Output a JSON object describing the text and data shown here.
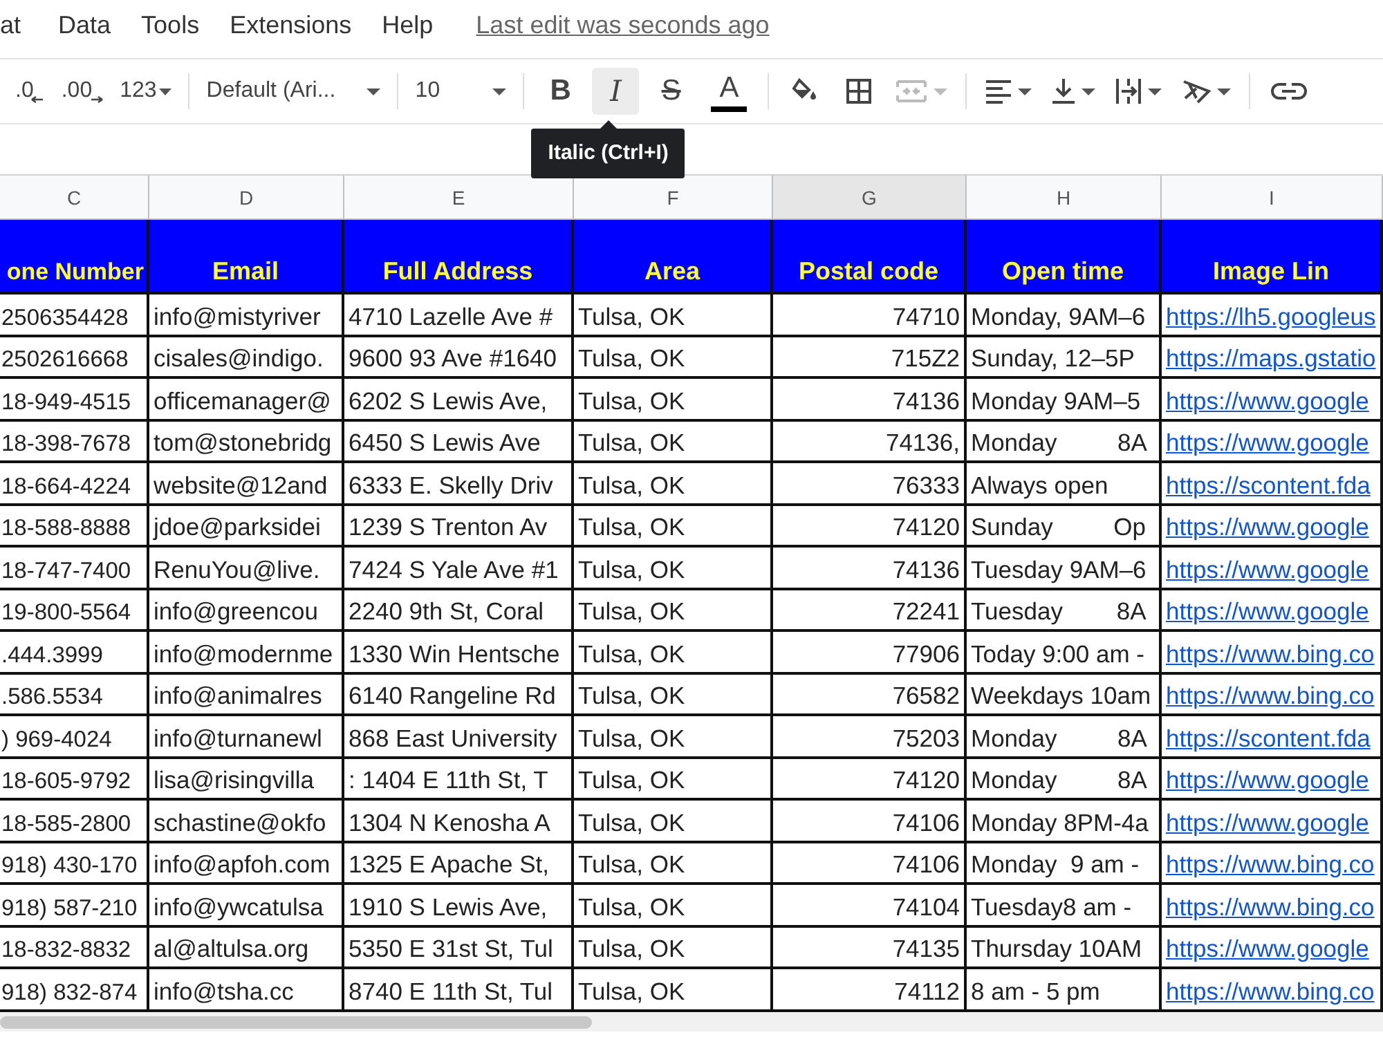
{
  "menu": {
    "items": [
      "at",
      "Data",
      "Tools",
      "Extensions",
      "Help"
    ],
    "last_edit": "Last edit was seconds ago"
  },
  "toolbar": {
    "decrease_decimal": ".0",
    "increase_decimal": ".00",
    "number_format": "123",
    "font": "Default (Ari...",
    "font_size": "10",
    "bold": {
      "label": "B",
      "hovered": false
    },
    "italic": {
      "label": "I",
      "hovered": true
    },
    "strikethrough": {
      "label": "S",
      "hovered": false
    },
    "text_color": {
      "label": "A",
      "color": "#000000"
    },
    "merge_cells": {
      "disabled": true
    },
    "tooltip": "Italic (Ctrl+I)"
  },
  "column_letters": [
    {
      "label": "C",
      "selected": false
    },
    {
      "label": "D",
      "selected": false
    },
    {
      "label": "E",
      "selected": false
    },
    {
      "label": "F",
      "selected": false
    },
    {
      "label": "G",
      "selected": true
    },
    {
      "label": "H",
      "selected": false
    },
    {
      "label": "I",
      "selected": false
    }
  ],
  "headers": [
    "one Number",
    "Email",
    "Full Address",
    "Area",
    "Postal code",
    "Open time",
    "Image Lin"
  ],
  "rows": [
    [
      "2506354428",
      "info@mistyriver",
      "4710 Lazelle Ave #",
      "Tulsa, OK",
      "74710",
      "Monday, 9AM–6",
      "https://lh5.googleus"
    ],
    [
      "2502616668",
      "cisales@indigo.",
      "9600 93 Ave #1640",
      "Tulsa, OK",
      "715Z2",
      "Sunday, 12–5P",
      "https://maps.gstatio"
    ],
    [
      "18-949-4515",
      "officemanager@",
      "6202 S Lewis Ave,",
      "Tulsa, OK",
      "74136",
      "Monday 9AM–5",
      "https://www.google"
    ],
    [
      "18-398-7678",
      "tom@stonebridg",
      "6450 S Lewis Ave",
      "Tulsa, OK",
      "74136,",
      "Monday         8A",
      "https://www.google"
    ],
    [
      "18-664-4224",
      "website@12and",
      "6333 E. Skelly Driv",
      "Tulsa, OK",
      "76333",
      "Always open",
      "https://scontent.fda"
    ],
    [
      "18-588-8888",
      "jdoe@parksidei",
      "1239 S Trenton Av",
      "Tulsa, OK",
      "74120",
      "Sunday         Op",
      "https://www.google"
    ],
    [
      "18-747-7400",
      "RenuYou@live.",
      "7424 S Yale Ave #1",
      "Tulsa, OK",
      "74136",
      "Tuesday 9AM–6",
      "https://www.google"
    ],
    [
      "19-800-5564",
      "info@greencou",
      "2240 9th St, Coral",
      "Tulsa, OK",
      "72241",
      "Tuesday        8A",
      "https://www.google"
    ],
    [
      ".444.3999",
      "info@modernme",
      "1330 Win Hentsche",
      "Tulsa, OK",
      "77906",
      "Today 9:00 am -",
      "https://www.bing.co"
    ],
    [
      ".586.5534",
      "info@animalres",
      "6140 Rangeline Rd",
      "Tulsa, OK",
      "76582",
      "Weekdays 10am",
      "https://www.bing.co"
    ],
    [
      ") 969-4024",
      "info@turnanewl",
      "868 East University",
      "Tulsa, OK",
      "75203",
      "Monday         8A",
      "https://scontent.fda"
    ],
    [
      "18-605-9792",
      "lisa@risingvilla",
      ": 1404 E 11th St, T",
      "Tulsa, OK",
      "74120",
      "Monday         8A",
      "https://www.google"
    ],
    [
      "18-585-2800",
      "schastine@okfo",
      "1304 N Kenosha A",
      "Tulsa, OK",
      "74106",
      "Monday 8PM-4a",
      "https://www.google"
    ],
    [
      "918) 430-170",
      "info@apfoh.com",
      "1325 E Apache St,",
      "Tulsa, OK",
      "74106",
      "Monday  9 am -",
      "https://www.bing.co"
    ],
    [
      "918) 587-210",
      "info@ywcatulsa",
      "1910 S Lewis Ave,",
      "Tulsa, OK",
      "74104",
      "Tuesday8 am -",
      "https://www.bing.co"
    ],
    [
      "18-832-8832",
      "al@altulsa.org",
      "5350 E 31st St, Tul",
      "Tulsa, OK",
      "74135",
      "Thursday 10AM",
      "https://www.google"
    ],
    [
      "918) 832-874",
      "info@tsha.cc",
      "8740 E 11th St, Tul",
      "Tulsa, OK",
      "74112",
      "8 am - 5 pm",
      "https://www.bing.co"
    ]
  ]
}
